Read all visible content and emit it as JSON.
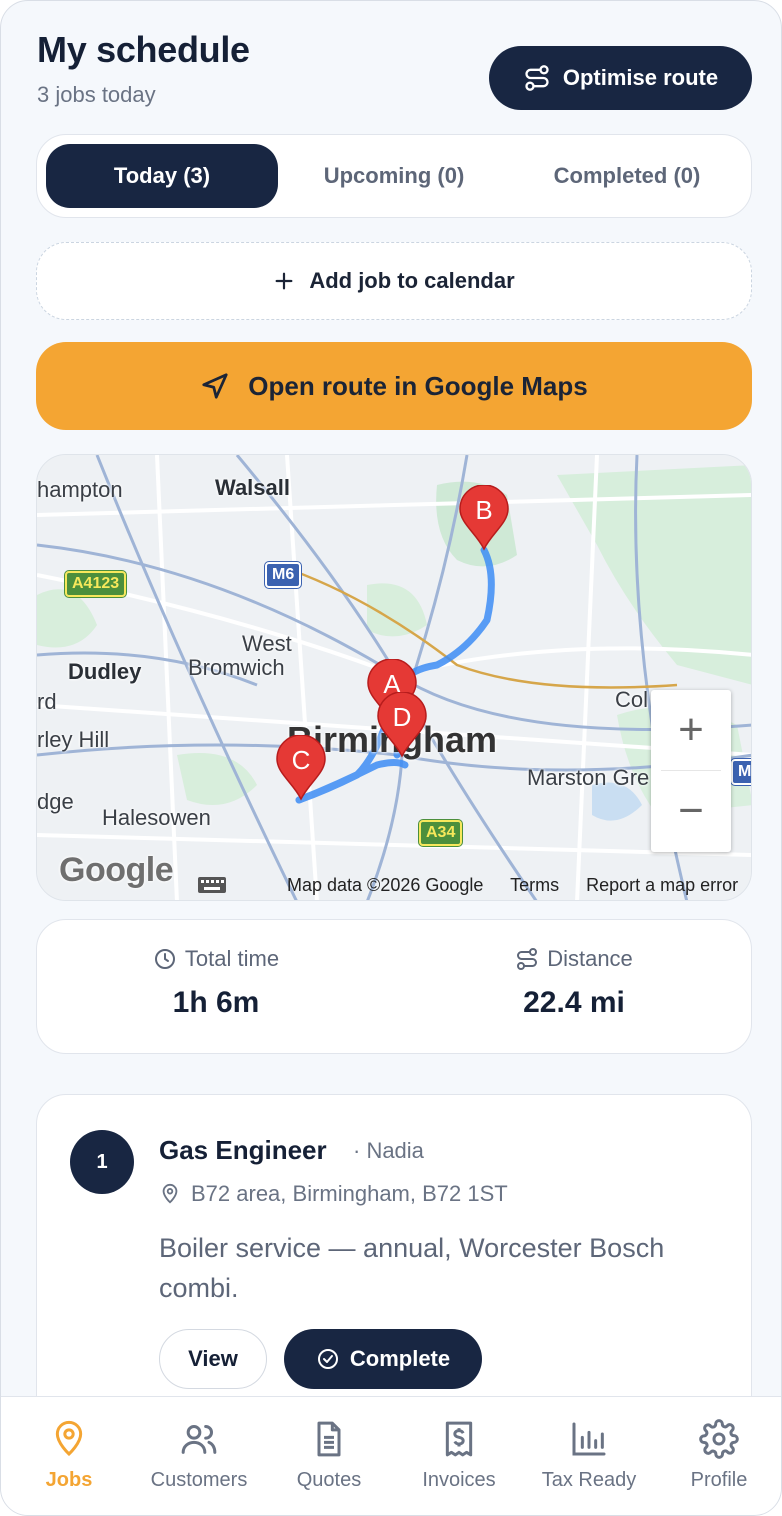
{
  "header": {
    "title": "My schedule",
    "subtitle": "3 jobs today",
    "optimise_label": "Optimise route"
  },
  "tabs": [
    {
      "label": "Today (3)",
      "active": true
    },
    {
      "label": "Upcoming (0)",
      "active": false
    },
    {
      "label": "Completed (0)",
      "active": false
    }
  ],
  "add_job_label": "Add job to calendar",
  "gmaps_label": "Open route in Google Maps",
  "map": {
    "places": {
      "hampton": "hampton",
      "walsall": "Walsall",
      "west": "West",
      "bromwich": "Bromwich",
      "dudley": "Dudley",
      "rd": "rd",
      "rley_hill": "rley Hill",
      "birmingham": "Birmingham",
      "dge": "dge",
      "halesowen": "Halesowen",
      "marston_green": "Marston Gre",
      "col": "Col"
    },
    "roads": {
      "a4123": "A4123",
      "m6": "M6",
      "a34": "A34",
      "m_right": "M"
    },
    "markers": [
      "A",
      "B",
      "C",
      "D"
    ],
    "zoom_in": "+",
    "zoom_out": "−",
    "logo": "Google",
    "footer": {
      "data": "Map data ©2026 Google",
      "terms": "Terms",
      "report": "Report a map error"
    },
    "colors": {
      "route": "#3d8df5",
      "marker": "#e53935"
    }
  },
  "stats": {
    "time_label": "Total time",
    "time_value": "1h 6m",
    "distance_label": "Distance",
    "distance_value": "22.4 mi"
  },
  "job": {
    "number": "1",
    "title": "Gas Engineer",
    "who": "· Nadia",
    "address": "B72 area, Birmingham, B72 1ST",
    "description": "Boiler service — annual, Worcester Bosch combi.",
    "view_label": "View",
    "complete_label": "Complete"
  },
  "nav": [
    {
      "label": "Jobs",
      "icon": "map-pin-icon",
      "active": true
    },
    {
      "label": "Customers",
      "icon": "users-icon",
      "active": false
    },
    {
      "label": "Quotes",
      "icon": "document-icon",
      "active": false
    },
    {
      "label": "Invoices",
      "icon": "receipt-icon",
      "active": false
    },
    {
      "label": "Tax Ready",
      "icon": "bar-chart-icon",
      "active": false
    },
    {
      "label": "Profile",
      "icon": "gear-icon",
      "active": false
    }
  ],
  "colors": {
    "navy": "#182642",
    "accent": "#f4a533"
  }
}
